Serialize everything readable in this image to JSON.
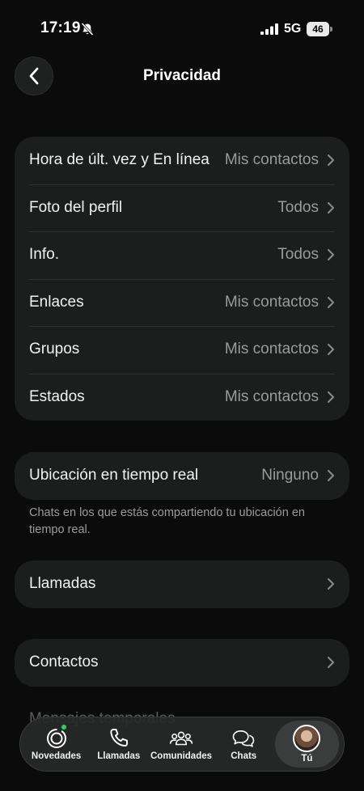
{
  "status_bar": {
    "time": "17:19",
    "network": "5G",
    "battery": "46"
  },
  "header": {
    "title": "Privacidad"
  },
  "privacy_group": [
    {
      "label": "Hora de últ. vez y En línea",
      "value": "Mis contactos"
    },
    {
      "label": "Foto del perfil",
      "value": "Todos"
    },
    {
      "label": "Info.",
      "value": "Todos"
    },
    {
      "label": "Enlaces",
      "value": "Mis contactos"
    },
    {
      "label": "Grupos",
      "value": "Mis contactos"
    },
    {
      "label": "Estados",
      "value": "Mis contactos"
    }
  ],
  "location": {
    "label": "Ubicación en tiempo real",
    "value": "Ninguno",
    "footnote": "Chats en los que estás compartiendo tu ubicación en tiempo real."
  },
  "calls": {
    "label": "Llamadas"
  },
  "contacts": {
    "label": "Contactos"
  },
  "next_section": {
    "label": "Mensajes temporales"
  },
  "bottom_nav": {
    "items": [
      {
        "label": "Novedades",
        "icon": "status-icon"
      },
      {
        "label": "Llamadas",
        "icon": "phone-icon"
      },
      {
        "label": "Comunidades",
        "icon": "communities-icon"
      },
      {
        "label": "Chats",
        "icon": "chats-icon"
      },
      {
        "label": "Tú",
        "icon": "avatar"
      }
    ],
    "active": "Tú",
    "accent": "#25d366"
  }
}
